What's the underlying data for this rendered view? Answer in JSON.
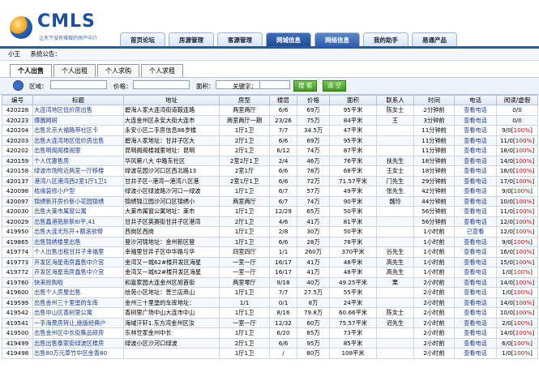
{
  "logo": {
    "name": "CMLS",
    "tagline": "让天下没有难做的房产中介"
  },
  "nav": [
    "首页论坛",
    "房源管理",
    "客源管理",
    "网城信息",
    "网络信息",
    "我的助手",
    "易通产品"
  ],
  "subbar": {
    "user": "小王",
    "notice_label": "系统公告："
  },
  "tabs": [
    "个人出售",
    "个人出租",
    "个人求购",
    "个人求租"
  ],
  "search": {
    "district_label": "区域：",
    "price_label": "价格：",
    "area_label": "面积：",
    "keyword_label": "关键字：",
    "search_btn": "搜 索",
    "clear_btn": "清 空"
  },
  "columns": [
    "编号",
    "标题",
    "地址",
    "房型",
    "楼层",
    "价格",
    "面积",
    "联系人",
    "时间",
    "电话",
    "阅读/虚假"
  ],
  "rows": [
    [
      "420228",
      "大连湾地区低价房出售",
      "碧海人家大连湾街道鞍连路",
      "两室两厅",
      "6/6",
      "69万",
      "95平米",
      "陈女士",
      "2分钟前",
      "查看电话",
      "0/0"
    ],
    [
      "420223",
      "爆園网树",
      "大连金州区永安大街大连市",
      "两室两厅一期",
      "23/26",
      "75万",
      "84平米",
      "王",
      "3分钟前",
      "查看电话",
      "0/0"
    ],
    [
      "420204",
      "出售北京大福路带社区卡",
      "永安小区二手房信息86岁楼",
      "1厅1卫",
      "7/7",
      "34.5万",
      "47平米",
      "",
      "11分钟前",
      "查看电话",
      "9/0[100%]"
    ],
    [
      "420203",
      "出售大连湾地区低价房出售",
      "碧海人家地址：甘井子区大",
      "2厅1卫",
      "6/6",
      "69万",
      "95平米",
      "",
      "11分钟前",
      "查看电话",
      "11/0[100%]"
    ],
    [
      "420202",
      "出售明阁阁楼阁里",
      "昆明阁阁楼城里地址：昆明",
      "2厅1卫",
      "6/12",
      "74万",
      "87平米",
      "",
      "11分钟前",
      "查看电话",
      "18/0[100%]"
    ],
    [
      "420159",
      "个人优惠售房",
      "华风第八大 中路东社区",
      "2室2厅1卫",
      "2/4",
      "46万",
      "76平米",
      "扶先生",
      "18分钟前",
      "查看电话",
      "14/0[100%]"
    ],
    [
      "420158",
      "绿波市场附近两室一厅移楼",
      "绿波花园沙河口区西北路13",
      "2室1厅",
      "6/6",
      "78万",
      "68平米",
      "王女士",
      "18分钟前",
      "查看电话",
      "18/0[100%]"
    ],
    [
      "420137",
      "港湾八区港湾西2室1厅1卫1",
      "甘井子区--港湾一港湾八区港",
      "2室1厅1卫",
      "6/6",
      "72万",
      "71.57平米",
      "门先生",
      "29分钟前",
      "查看电话",
      "17/0[100%]"
    ],
    [
      "420098",
      "桔缘装修小户型",
      "绿波小区绿波路沙河口一绿波",
      "1厅1卫",
      "6/7",
      "57万",
      "49平米",
      "张先生",
      "42分钟前",
      "查看电话",
      "9/0[100%]"
    ],
    [
      "420097",
      "锦绣新开房价新小花园锦绣",
      "锦绣锦江园沙河口区锦绣小",
      "两室两厅",
      "6/7",
      "74万",
      "90平米",
      "魏玲",
      "44分钟前",
      "查看电话",
      "10/0[100%]"
    ],
    [
      "420030",
      "出售大莱市属窗公寓",
      "大莱市属窗公寓地址：莱市",
      "1厅1卫",
      "12/29",
      "65万",
      "50平米",
      "",
      "56分钟前",
      "查看电话",
      "11/0[100%]"
    ],
    [
      "420029",
      "出售鑫港苑新新8I平,41",
      "甘井子区英赛街甘井子区港湾",
      "2厅1卫",
      "4/6",
      "41万",
      "81平米",
      "",
      "56分钟前",
      "查看电话",
      "12/0[100%]"
    ],
    [
      "419950",
      "出售大连无形开+额滚欲帮",
      "西岗区西岗",
      "1厅1卫",
      "2/8",
      "30万",
      "50平米",
      "",
      "1小时前",
      "已查看",
      "12/0[100%]"
    ],
    [
      "419865",
      "出售锦绣楼里出售",
      "登沙河锦地址：金州新区登",
      "1厅1卫",
      "6/6",
      "28万",
      "78平米",
      "",
      "1小时前",
      "查看电话",
      "9/0[100%]"
    ],
    [
      "419774",
      "个人出售出租甘井子幸福里",
      "幸福里甘井子区中华路与华",
      "四室四厅",
      "1/1",
      "260万",
      "370平米",
      "谷先生",
      "1小时前",
      "查看电话",
      "16/0[100%]"
    ],
    [
      "419773",
      "开发区海星南房鑫售中介宫",
      "金湾又一城62#楼开发区海星",
      "一室一厅",
      "16/17",
      "41万",
      "48平米",
      "高先生",
      "1小时前",
      "查看电话",
      "15/0[100%]"
    ],
    [
      "419772",
      "开发区海星南房鑫售中介宫",
      "金湾又一城62#楼开发区海星",
      "一室一厅",
      "16/17",
      "41万",
      "48平米",
      "高先生",
      "1小时前",
      "查看电话",
      "1/0[100%]"
    ],
    [
      "419760",
      "快来抢购啦",
      "和嘉家园大连金州区旭首街",
      "两室零厅",
      "9/18",
      "40万",
      "49.25平米",
      "栗",
      "2小时前",
      "查看电话",
      "14/0[100%]"
    ],
    [
      "419600",
      "出售个人房屋出售",
      "绘苑小区地址：普兰店商山",
      "1厅1卫",
      "7/7",
      "27.5万",
      "55平米",
      "",
      "2小时前",
      "查看电话",
      "1/0[100%]"
    ],
    [
      "419599",
      "出售金州三十里堡的车库",
      "金州三十里堡的车库地址：",
      "1/1",
      "0/1",
      "8万",
      "24平米",
      "",
      "2小时前",
      "查看电话",
      "14/0[100%]"
    ],
    [
      "419542",
      "出售中山区香树里公寓",
      "香树里广场中山大连市中山",
      "1厅1卫",
      "8/16",
      "79.8万",
      "60.66平米",
      "陈女士",
      "2小时前",
      "查看电话",
      "10/0[100%]"
    ],
    [
      "419541",
      "一手海景房转让,绝版经典户",
      "海域汗轩1.东方湾金州区汝",
      "一室一厅",
      "12/32",
      "60万",
      "75.57平米",
      "迟先生",
      "2小时前",
      "查看电话",
      "2/0[100%]"
    ],
    [
      "419500",
      "出售金州区中长街集品研房",
      "东林世家金州中长",
      "1厅1卫",
      "6/20",
      "85万",
      "73平米",
      "",
      "2小时前",
      "查看电话",
      "14/0[100%]"
    ],
    [
      "419499",
      "出售出售泰家街绿波区楼房",
      "绿波小区沙河口绿波",
      "2厅1卫",
      "6/6",
      "95万",
      "85平米",
      "",
      "2小时前",
      "查看电话",
      "6/0[100%]"
    ],
    [
      "419498",
      "出售80万元草竹中区金香80",
      "",
      "1厅1卫",
      "/",
      "80万",
      "108平米",
      "",
      "2小时前",
      "查看电话",
      "1/0[100%]"
    ]
  ]
}
